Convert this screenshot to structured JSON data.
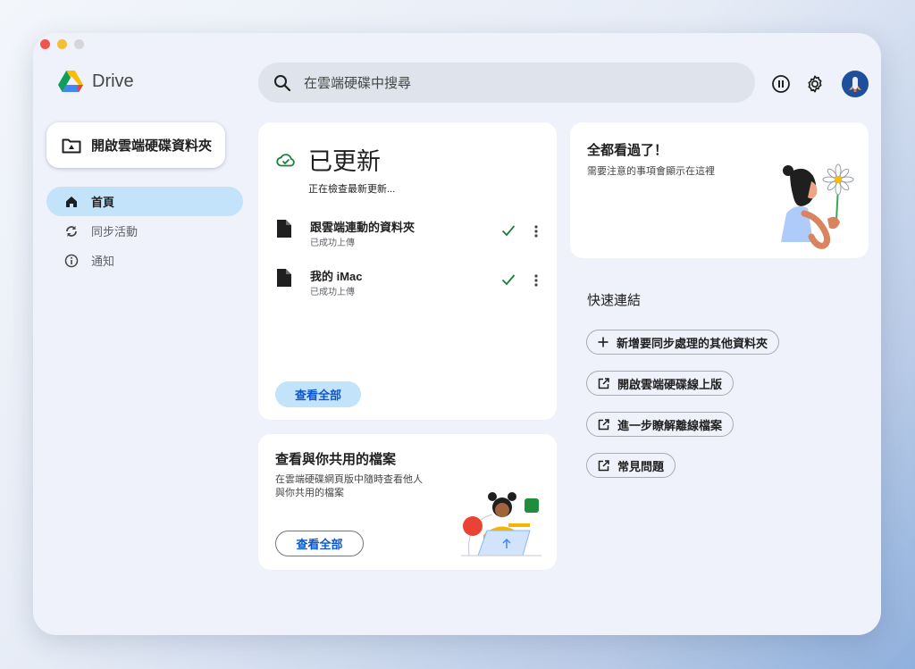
{
  "app": {
    "name": "Drive"
  },
  "search": {
    "placeholder": "在雲端硬碟中搜尋"
  },
  "sidebar": {
    "open_folder_label": "開啟雲端硬碟資料夾",
    "items": [
      {
        "label": "首頁",
        "icon": "home-icon",
        "active": true
      },
      {
        "label": "同步活動",
        "icon": "sync-icon",
        "active": false
      },
      {
        "label": "通知",
        "icon": "info-icon",
        "active": false
      }
    ]
  },
  "updated_card": {
    "title": "已更新",
    "subtitle": "正在檢查最新更新...",
    "files": [
      {
        "name": "跟雲端連動的資料夾",
        "status": "已成功上傳"
      },
      {
        "name": "我的 iMac",
        "status": "已成功上傳"
      }
    ],
    "view_all_label": "查看全部"
  },
  "shared_card": {
    "title": "查看與你共用的檔案",
    "desc_line1": "在雲端硬碟網頁版中隨時查看他人",
    "desc_line2": "與你共用的檔案",
    "view_all_label": "查看全部"
  },
  "caught_up_card": {
    "title": "全都看過了！",
    "desc": "需要注意的事項會顯示在這裡"
  },
  "quick_links": {
    "title": "快速連結",
    "items": [
      {
        "label": "新增要同步處理的其他資料夾",
        "icon": "plus-icon"
      },
      {
        "label": "開啟雲端硬碟線上版",
        "icon": "open-external-icon"
      },
      {
        "label": "進一步瞭解離線檔案",
        "icon": "open-external-icon"
      },
      {
        "label": "常見問題",
        "icon": "open-external-icon"
      }
    ]
  },
  "colors": {
    "accent": "#0b57d0",
    "active_nav": "#c3e3fb",
    "success": "#188038"
  }
}
